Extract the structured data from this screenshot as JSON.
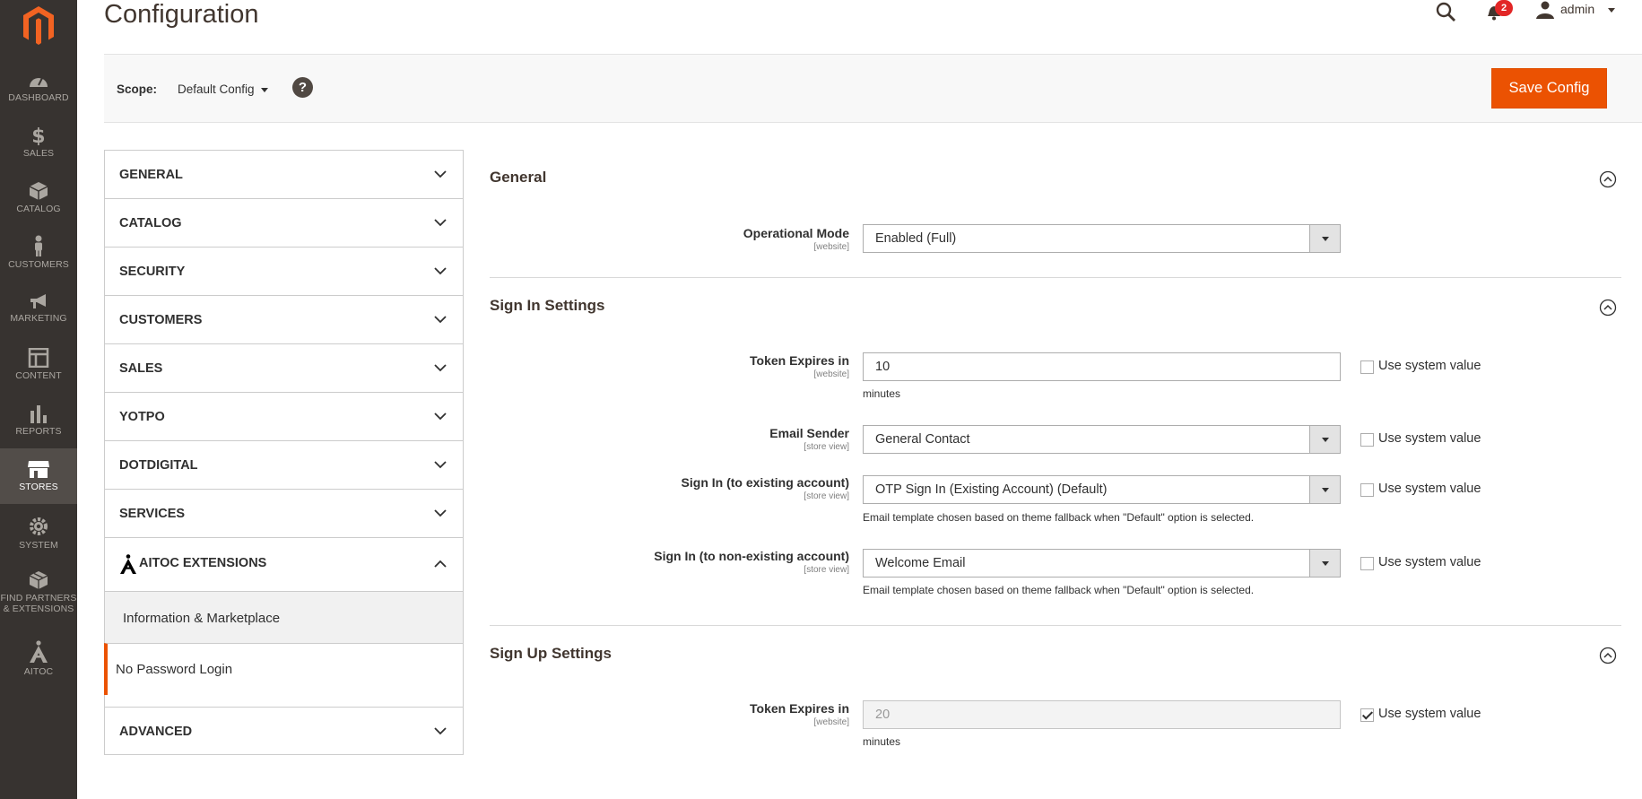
{
  "nav": {
    "items": [
      {
        "id": "dashboard",
        "label": "DASHBOARD"
      },
      {
        "id": "sales",
        "label": "SALES"
      },
      {
        "id": "catalog",
        "label": "CATALOG"
      },
      {
        "id": "customers",
        "label": "CUSTOMERS"
      },
      {
        "id": "marketing",
        "label": "MARKETING"
      },
      {
        "id": "content",
        "label": "CONTENT"
      },
      {
        "id": "reports",
        "label": "REPORTS"
      },
      {
        "id": "stores",
        "label": "STORES"
      },
      {
        "id": "system",
        "label": "SYSTEM"
      },
      {
        "id": "partners",
        "label_line1": "FIND PARTNERS",
        "label_line2": "& EXTENSIONS"
      },
      {
        "id": "aitoc",
        "label": "AITOC"
      }
    ],
    "active": "stores"
  },
  "header": {
    "title": "Configuration",
    "notifications_count": "2",
    "user": "admin"
  },
  "scope": {
    "label": "Scope:",
    "value": "Default Config",
    "help": "?",
    "save_label": "Save Config"
  },
  "tabs": {
    "general": "GENERAL",
    "catalog": "CATALOG",
    "security": "SECURITY",
    "customers": "CUSTOMERS",
    "sales": "SALES",
    "yotpo": "YOTPO",
    "dotdigital": "DOTDIGITAL",
    "services": "SERVICES",
    "aitoc": "AITOC EXTENSIONS",
    "aitoc_items": [
      "Information & Marketplace",
      "No Password Login"
    ],
    "advanced": "ADVANCED"
  },
  "sections": {
    "general": {
      "title": "General",
      "operational_mode": {
        "label": "Operational Mode",
        "scope": "[website]",
        "value": "Enabled (Full)"
      }
    },
    "sign_in": {
      "title": "Sign In Settings",
      "token": {
        "label": "Token Expires in",
        "scope": "[website]",
        "value": "10",
        "note": "minutes",
        "system": "Use system value",
        "system_checked": false
      },
      "email_sender": {
        "label": "Email Sender",
        "scope": "[store view]",
        "value": "General Contact",
        "system": "Use system value",
        "system_checked": false
      },
      "existing": {
        "label": "Sign In (to existing account)",
        "scope": "[store view]",
        "value": "OTP Sign In (Existing Account) (Default)",
        "note": "Email template chosen based on theme fallback when \"Default\" option is selected.",
        "system": "Use system value",
        "system_checked": false
      },
      "non_existing": {
        "label": "Sign In (to non-existing account)",
        "scope": "[store view]",
        "value": "Welcome Email",
        "note": "Email template chosen based on theme fallback when \"Default\" option is selected.",
        "system": "Use system value",
        "system_checked": false
      }
    },
    "sign_up": {
      "title": "Sign Up Settings",
      "token": {
        "label": "Token Expires in",
        "scope": "[website]",
        "value": "20",
        "note": "minutes",
        "system": "Use system value",
        "system_checked": true
      }
    }
  },
  "colors": {
    "accent": "#eb5202",
    "nav_bg": "#373330",
    "nav_active": "#524d49"
  }
}
